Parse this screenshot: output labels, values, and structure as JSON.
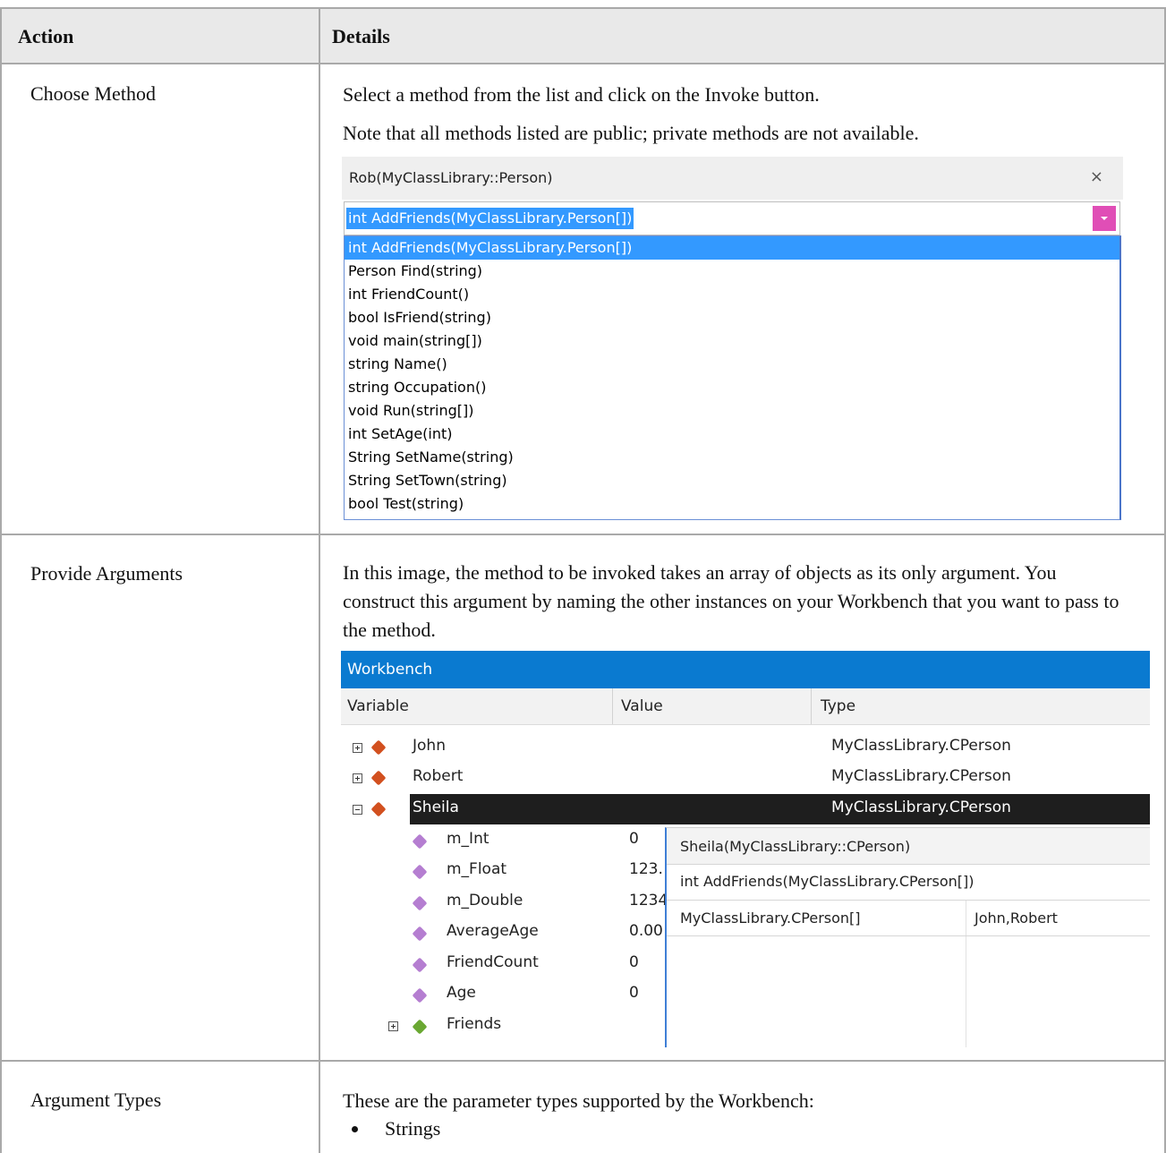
{
  "table": {
    "headers": {
      "action": "Action",
      "details": "Details"
    },
    "rows": [
      {
        "action": "Choose Method",
        "paragraphs": [
          "Select a method from the list and click on the Invoke button.",
          "Note that all methods listed are public; private methods are not available."
        ]
      },
      {
        "action": "Provide Arguments",
        "paragraphs": [
          "In this image, the method to be invoked takes an array of objects as its only argument. You construct this argument by naming the other instances on your Workbench that you want to pass to the method."
        ]
      },
      {
        "action": "Argument Types",
        "paragraphs": [
          "These are the parameter types supported by the Workbench:"
        ],
        "bullets": [
          "Strings"
        ]
      }
    ]
  },
  "method_picker": {
    "title": "Rob(MyClassLibrary::Person)",
    "close_glyph": "×",
    "selected": "int AddFriends(MyClassLibrary.Person[])",
    "options": [
      "int AddFriends(MyClassLibrary.Person[])",
      "Person Find(string)",
      "int FriendCount()",
      "bool IsFriend(string)",
      "void main(string[])",
      "string Name()",
      "string Occupation()",
      "void Run(string[])",
      "int SetAge(int)",
      "String SetName(string)",
      "String SetTown(string)",
      "bool Test(string)"
    ]
  },
  "workbench": {
    "title": "Workbench",
    "columns": [
      "Variable",
      "Value",
      "Type"
    ],
    "instances": [
      {
        "name": "John",
        "type": "MyClassLibrary.CPerson",
        "expanded": false
      },
      {
        "name": "Robert",
        "type": "MyClassLibrary.CPerson",
        "expanded": false
      },
      {
        "name": "Sheila",
        "type": "MyClassLibrary.CPerson",
        "expanded": true,
        "selected": true
      }
    ],
    "members": [
      {
        "name": "m_Int",
        "value": "0"
      },
      {
        "name": "m_Float",
        "value": "123."
      },
      {
        "name": "m_Double",
        "value": "1234"
      },
      {
        "name": "AverageAge",
        "value": "0.00"
      },
      {
        "name": "FriendCount",
        "value": "0"
      },
      {
        "name": "Age",
        "value": "0"
      },
      {
        "name": "Friends",
        "value": ""
      }
    ],
    "invoke_popup": {
      "title": "Sheila(MyClassLibrary::CPerson)",
      "method": "int AddFriends(MyClassLibrary.CPerson[])",
      "arg_type": "MyClassLibrary.CPerson[]",
      "arg_value": "John,Robert"
    },
    "colors": {
      "titlebar": "#0a7ad0",
      "selection": "#1e1e1e"
    }
  }
}
